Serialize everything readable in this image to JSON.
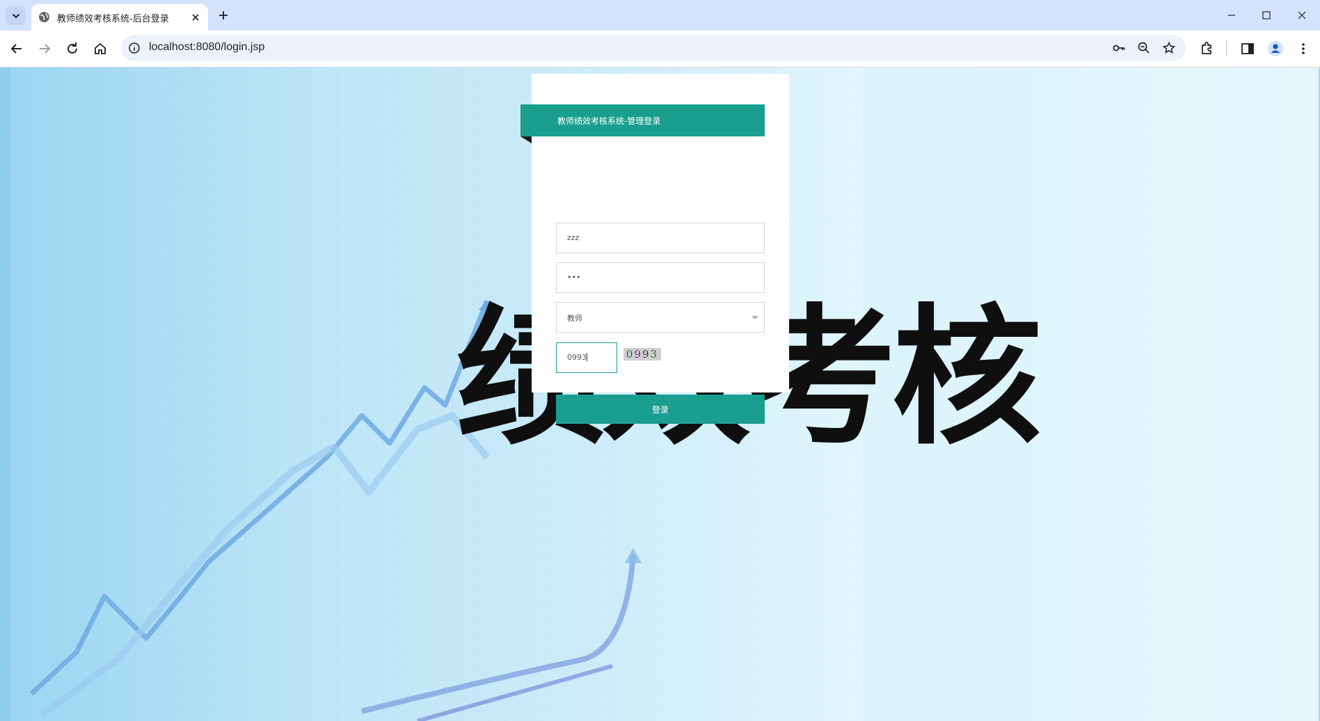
{
  "browser": {
    "tab": {
      "title": "教师绩效考核系统-后台登录",
      "favicon": "globe-icon"
    },
    "address_bar": {
      "url": "localhost:8080/login.jsp"
    },
    "icons": [
      "tab-search-icon",
      "back-icon",
      "forward-icon",
      "reload-icon",
      "home-icon",
      "site-info-icon",
      "password-key-icon",
      "zoom-icon",
      "bookmark-star-icon",
      "extensions-icon",
      "side-panel-icon",
      "profile-icon",
      "menu-icon",
      "minimize-icon",
      "maximize-icon",
      "close-icon"
    ]
  },
  "page": {
    "background_text": "绩效考核",
    "login": {
      "title": "教师绩效考核系统-管理登录",
      "username_value": "zzz",
      "password_value": "•••",
      "role_selected": "教师",
      "captcha_input": "0993",
      "captcha_image_text": [
        "0",
        "9",
        "9",
        "3"
      ],
      "submit_label": "登录"
    }
  },
  "colors": {
    "accent": "#1a9e8f",
    "tabstrip": "#d3e3fd",
    "omnibox": "#edf2fa"
  }
}
